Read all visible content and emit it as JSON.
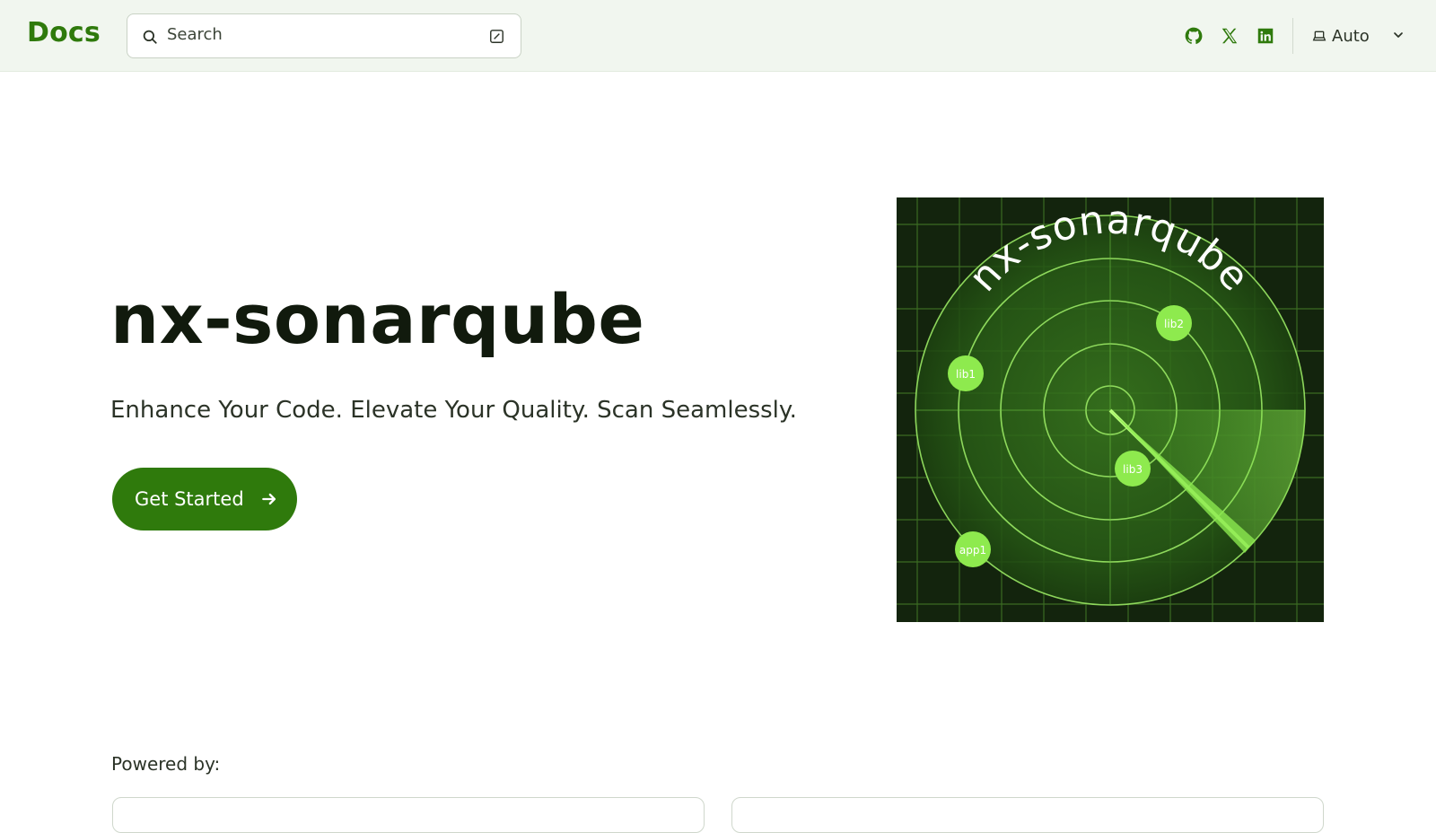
{
  "header": {
    "logo": "Docs",
    "search": {
      "placeholder": "Search"
    },
    "theme": {
      "label": "Auto"
    },
    "social": [
      "github-icon",
      "x-icon",
      "linkedin-icon"
    ]
  },
  "hero": {
    "title": "nx-sonarqube",
    "subtitle": "Enhance Your Code. Elevate Your Quality. Scan Seamlessly.",
    "cta_label": "Get Started",
    "image": {
      "curved_text": "nx-sonarqube",
      "blips": [
        "lib1",
        "lib2",
        "lib3",
        "app1"
      ]
    }
  },
  "powered_by": {
    "label": "Powered by:"
  },
  "colors": {
    "accent": "#2f7a0c",
    "header_bg": "#f1f6ef",
    "radar_bg": "#13240d"
  }
}
